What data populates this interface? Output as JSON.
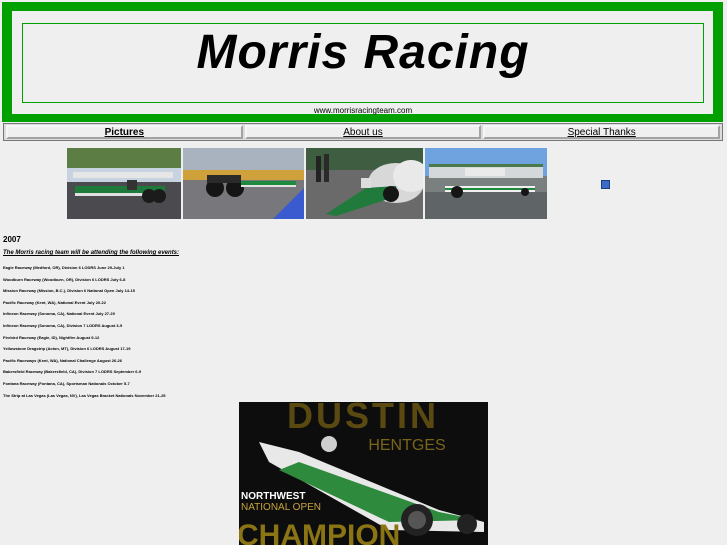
{
  "header": {
    "title": "Morris Racing",
    "url": "www.morrisracingteam.com"
  },
  "nav": {
    "items": [
      {
        "label": "Pictures"
      },
      {
        "label": "About us"
      },
      {
        "label": "Special Thanks"
      }
    ]
  },
  "photos": [
    {
      "name": "dragster-in-pits-photo"
    },
    {
      "name": "dragster-rear-view-photo"
    },
    {
      "name": "dragster-burnout-photo"
    },
    {
      "name": "dragster-on-track-photo"
    }
  ],
  "events": {
    "year": "2007",
    "heading": "The Morris racing team will be attending the following events:",
    "items": [
      "Eagle Raceway (Medford, OR), Division 6 LODRS June 29-July 1",
      "Woodburn Raceway (Woodburn, OR), Division 6 LODRS July 6-8",
      "Mission Raceway (Mission, B.C.), Division 6 National Open July 14-15",
      "Pacific Raceway (Kent, WA), National Event July 20-22",
      "Infineon Raceway (Sonoma, CA), National Event July 27-29",
      "Infineon Raceway (Sonoma, CA), Division 7 LODRS August 3-5",
      "Firebird Raceway (Eagle, ID), Nightfire August 9-12",
      "Yellowstone Dragstrip (Acton, MT), Division 6 LODRS August 17-19",
      "Pacific Raceways (Kent, WA), National Challenge August 26-26",
      "Bakersfield Raceway (Bakersfield, CA), Division 7 LODRS September 6-9",
      "Fontana Raceway (Fontana, CA), Sportsman Nationals October 5-7",
      "The Strip at Las Vegas (Las Vegas, NV), Las Vegas Bracket Nationals November 21-25"
    ]
  },
  "banner": {
    "name_top": "DUSTIN",
    "name_sub": "HENTGES",
    "line1": "NORTHWEST",
    "line2": "NATIONAL OPEN",
    "line3": "CHAMPION"
  }
}
